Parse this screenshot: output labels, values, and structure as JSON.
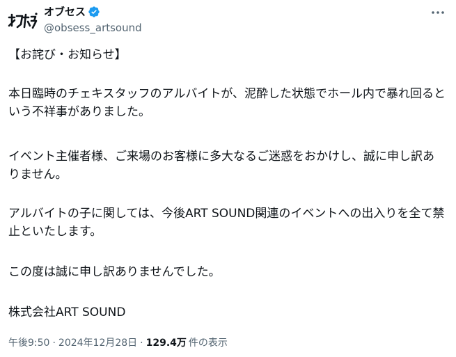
{
  "author": {
    "display_name": "オブセス",
    "handle": "@obsess_artsound",
    "avatar_icon": "obsess-logo-icon",
    "verified_icon": "verified-badge-icon",
    "verified_color": "#1d9bf0"
  },
  "menu": {
    "more_icon": "more-options-icon"
  },
  "tweet": {
    "title": "【お詫び・お知らせ】",
    "paragraph_1": "本日臨時のチェキスタッフのアルバイトが、泥酔した状態でホール内で暴れ回るという不祥事がありました。",
    "paragraph_2": "イベント主催者様、ご来場のお客様に多大なるご迷惑をおかけし、誠に申し訳ありません。",
    "paragraph_3": "アルバイトの子に関しては、今後ART SOUND関連のイベントへの出入りを全て禁止といたします。",
    "paragraph_4": "この度は誠に申し訳ありませんでした。",
    "signature": "株式会社ART SOUND"
  },
  "meta": {
    "time": "午後9:50",
    "separator": "·",
    "date": "2024年12月28日",
    "views_count": "129.4万",
    "views_label": "件の表示"
  },
  "colors": {
    "text_primary": "#0f1419",
    "text_secondary": "#536471",
    "accent": "#1d9bf0"
  }
}
